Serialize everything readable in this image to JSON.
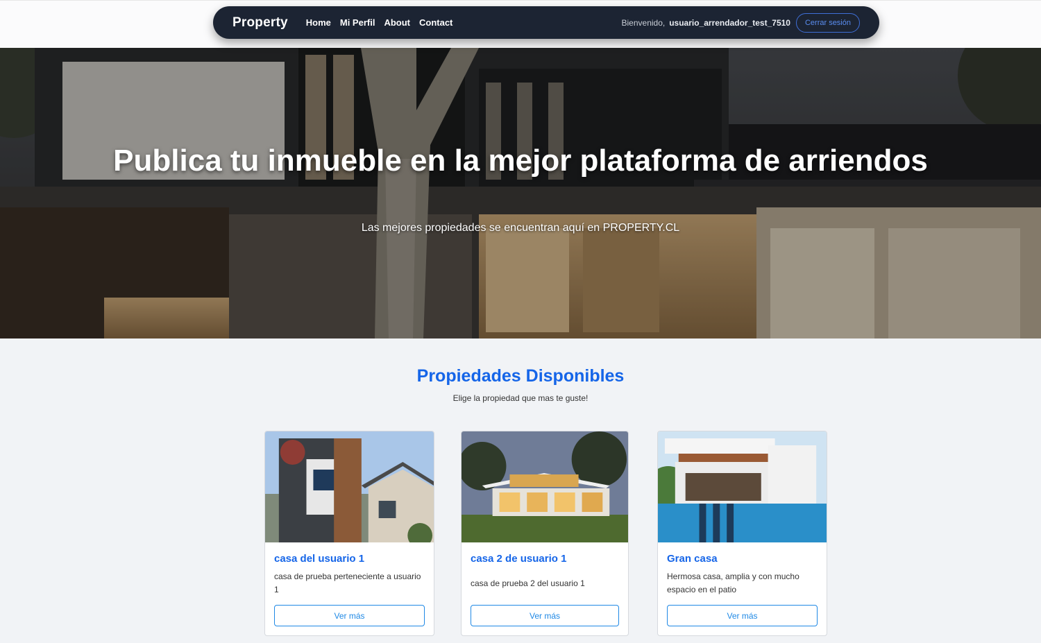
{
  "navbar": {
    "brand": "Property",
    "links": [
      "Home",
      "Mi Perfil",
      "About",
      "Contact"
    ],
    "welcome_text": "Bienvenido,",
    "username": "usuario_arrendador_test_7510",
    "logout_label": "Cerrar sesión"
  },
  "hero": {
    "title": "Publica tu inmueble en la mejor plataforma de arriendos",
    "subtitle": "Las mejores propiedades se encuentran aquí en PROPERTY.CL"
  },
  "section": {
    "title": "Propiedades Disponibles",
    "subtitle": "Elige la propiedad que mas te guste!"
  },
  "properties": [
    {
      "title": "casa del usuario 1",
      "description": "casa de prueba perteneciente a usuario 1",
      "button": "Ver más"
    },
    {
      "title": "casa 2 de usuario 1",
      "description": "casa de prueba 2 del usuario 1",
      "button": "Ver más"
    },
    {
      "title": "Gran casa",
      "description": "Hermosa casa, amplia y con mucho espacio en el patio",
      "button": "Ver más"
    }
  ],
  "colors": {
    "navbar_bg": "#1c2433",
    "accent": "#1565e8",
    "button_outline": "#1e88e5",
    "page_bg": "#f1f3f6"
  }
}
